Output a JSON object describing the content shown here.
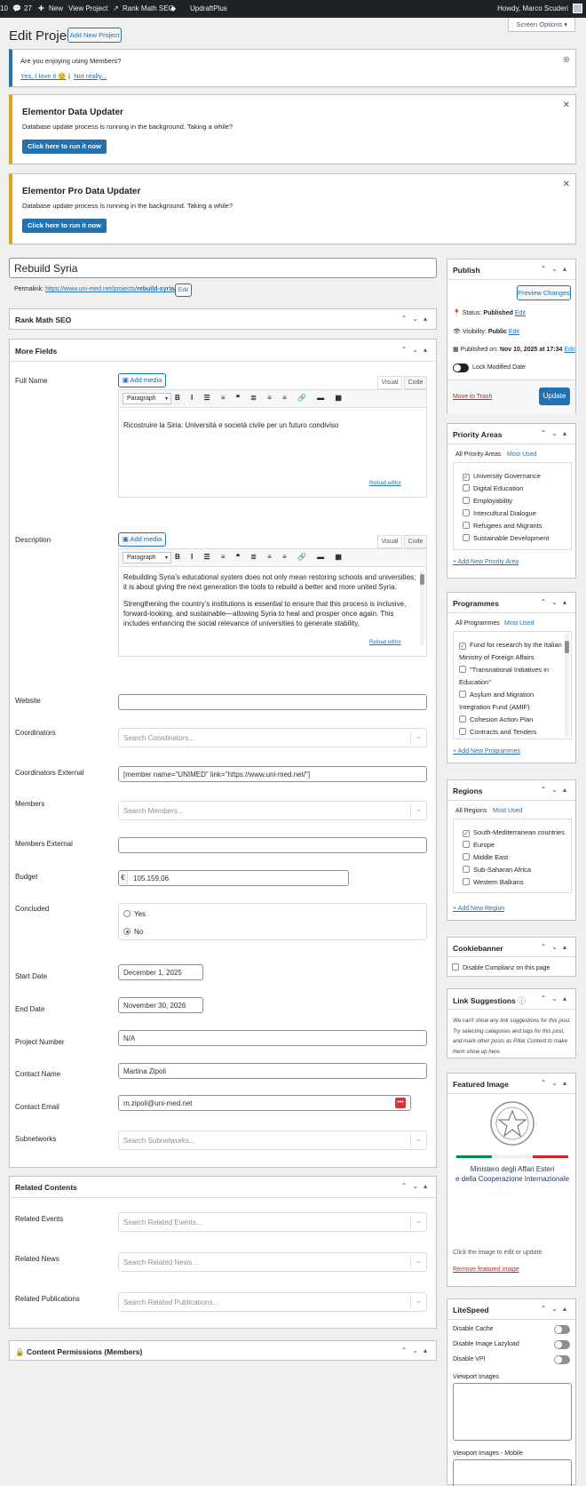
{
  "adminbar": {
    "site_num": "10",
    "comments": "27",
    "new_label": "New",
    "view_label": "View Project",
    "seo_label": "Rank Math SEO",
    "updraft_label": "UpdraftPlus",
    "howdy": "Howdy, Marco Scuderi"
  },
  "screen_options": "Screen Options ▾",
  "page": {
    "title": "Edit Project",
    "add_new": "Add New Project"
  },
  "notice_members": {
    "question": "Are you enjoying using Members?",
    "yes": "Yes, I love it 😊",
    "sep": "|",
    "no": "Not really..."
  },
  "notice_elementor": {
    "title": "Elementor Data Updater",
    "desc": "Database update process is running in the background. Taking a while?",
    "button": "Click here to run it now"
  },
  "notice_elementor_pro": {
    "title": "Elementor Pro Data Updater",
    "desc": "Database update process is running in the background. Taking a while?",
    "button": "Click here to run it now"
  },
  "post": {
    "title": "Rebuild Syria",
    "permalink_label": "Permalink:",
    "permalink_base": "https://www.uni-med.net/projects/",
    "permalink_slug": "rebuild-syria",
    "permalink_end": "/",
    "edit": "Edit"
  },
  "rankmath": {
    "title": "Rank Math SEO"
  },
  "more_fields": {
    "title": "More Fields",
    "add_media": "Add media",
    "visual": "Visual",
    "code": "Code",
    "paragraph": "Paragraph",
    "reload": "Reload editor",
    "full_name": {
      "label": "Full Name",
      "value": "Ricostruire la Siria: Università e società civile per un futuro condiviso"
    },
    "description": {
      "label": "Description",
      "p1": "Rebuilding Syria’s educational system does not only mean restoring schools and universities; it is about giving the next generation the tools to rebuild a better and more united Syria.",
      "p2": "Strengthening the country’s institutions is essential to ensure that this process is inclusive, forward-looking, and sustainable—allowing Syria to heal and prosper once again. This includes enhancing the social relevance of universities to generate stability,"
    },
    "website": {
      "label": "Website",
      "value": ""
    },
    "coordinators": {
      "label": "Coordinators",
      "placeholder": "Search Coordinators..."
    },
    "coordinators_external": {
      "label": "Coordinators External",
      "value": "[member name=\"UNIMED\" link=\"https://www.uni-med.net/\"]"
    },
    "members": {
      "label": "Members",
      "placeholder": "Search Members..."
    },
    "members_external": {
      "label": "Members External",
      "value": ""
    },
    "budget": {
      "label": "Budget",
      "currency": "€",
      "value": "105.159,06"
    },
    "concluded": {
      "label": "Concluded",
      "yes": "Yes",
      "no": "No"
    },
    "start_date": {
      "label": "Start Date",
      "value": "December 1, 2025"
    },
    "end_date": {
      "label": "End Date",
      "value": "November 30, 2026"
    },
    "project_number": {
      "label": "Project Number",
      "value": "N/A"
    },
    "contact_name": {
      "label": "Contact Name",
      "value": "Martina Zipoli"
    },
    "contact_email": {
      "label": "Contact Email",
      "value": "m.zipoli@uni-med.net"
    },
    "subnetworks": {
      "label": "Subnetworks",
      "placeholder": "Search Subnetworks..."
    }
  },
  "related": {
    "title": "Related Contents",
    "events": {
      "label": "Related Events",
      "placeholder": "Search Related Events..."
    },
    "news": {
      "label": "Related News",
      "placeholder": "Search Related News..."
    },
    "publications": {
      "label": "Related Publications",
      "placeholder": "Search Related Publications..."
    }
  },
  "permissions": {
    "title": "Content Permissions (Members)"
  },
  "publish": {
    "title": "Publish",
    "preview": "Preview Changes",
    "status_label": "Status:",
    "status_value": "Published",
    "visibility_label": "Visibility:",
    "visibility_value": "Public",
    "published_label": "Published on:",
    "published_value": "Nov 10, 2025 at 17:34",
    "edit": "Edit",
    "lock": "Lock Modified Date",
    "trash": "Move to Trash",
    "update": "Update"
  },
  "priority_areas": {
    "title": "Priority Areas",
    "tab_all": "All Priority Areas",
    "tab_most": "Most Used",
    "items": [
      {
        "label": "University Governance",
        "checked": true
      },
      {
        "label": "Digital Education",
        "checked": false
      },
      {
        "label": "Employability",
        "checked": false
      },
      {
        "label": "Intercultural Dialogue",
        "checked": false
      },
      {
        "label": "Refugees and Migrants",
        "checked": false
      },
      {
        "label": "Sustainable Development",
        "checked": false
      }
    ],
    "add": "+ Add New Priority Area"
  },
  "programmes": {
    "title": "Programmes",
    "tab_all": "All Programmes",
    "tab_most": "Most Used",
    "items": [
      {
        "line1": "Fund for research by the Italian",
        "line2": "Ministry of Foreign Affairs",
        "checked": true
      },
      {
        "line1": "\"Transnational Initiatives in",
        "line2": "Education\"",
        "checked": false
      },
      {
        "line1": "Asylum and Migration",
        "line2": "Integration Fund (AMIF)",
        "checked": false
      },
      {
        "line1": "Cohesion Action Plan",
        "line2": "",
        "checked": false
      },
      {
        "line1": "Contracts and Tenders",
        "line2": "",
        "checked": false
      }
    ],
    "add": "+ Add New Programmes"
  },
  "regions": {
    "title": "Regions",
    "tab_all": "All Regions",
    "tab_most": "Most Used",
    "items": [
      {
        "label": "South-Mediterranean countries",
        "checked": true
      },
      {
        "label": "Europe",
        "checked": false
      },
      {
        "label": "Middle East",
        "checked": false
      },
      {
        "label": "Sub-Saharan Africa",
        "checked": false
      },
      {
        "label": "Western Balkans",
        "checked": false
      }
    ],
    "add": "+ Add New Region"
  },
  "cookiebanner": {
    "title": "Cookiebanner",
    "label": "Disable Complianz on this page"
  },
  "link_suggestions": {
    "title": "Link Suggestions",
    "text": "We can't show any link suggestions for this post. Try selecting categories and tags for this post, and mark other posts as Pillar Content to make them show up here."
  },
  "featured": {
    "title": "Featured Image",
    "logo_line1": "Ministero degli Affari Esteri",
    "logo_line2": "e della Cooperazione Internazionale",
    "hint": "Click the image to edit or update",
    "remove": "Remove featured image"
  },
  "litespeed": {
    "title": "LiteSpeed",
    "cache": "Disable Cache",
    "lazy": "Disable Image Lazyload",
    "vpi": "Disable VPI",
    "vp_images": "Viewport Images",
    "vp_images_mobile": "Viewport Images - Mobile"
  }
}
